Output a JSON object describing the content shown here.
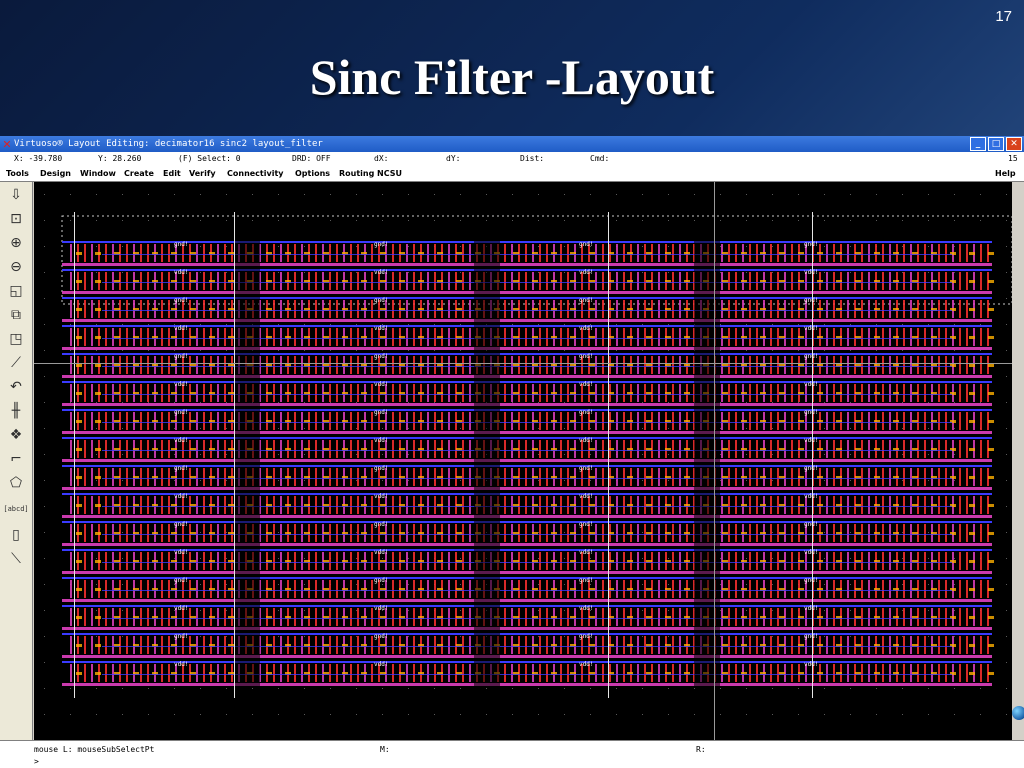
{
  "slide": {
    "number": "17",
    "title": "Sinc Filter -Layout"
  },
  "window": {
    "title": "Virtuoso® Layout Editing: decimator16 sinc2 layout_filter",
    "controls": [
      "minimize",
      "maximize",
      "close"
    ]
  },
  "status": {
    "x": "X: -39.780",
    "y": "Y: 28.260",
    "select": "(F) Select: 0",
    "drd": "DRD: OFF",
    "dx": "dX:",
    "dy": "dY:",
    "dist": "Dist:",
    "cmd": "Cmd:",
    "right_value": "15"
  },
  "menu": {
    "items": [
      "Tools",
      "Design",
      "Window",
      "Create",
      "Edit",
      "Verify",
      "Connectivity",
      "Options",
      "Routing",
      "NCSU"
    ],
    "help": "Help"
  },
  "toolbar": {
    "icons": [
      "save-icon",
      "zoom-fit-icon",
      "zoom-in-icon",
      "zoom-out-icon",
      "stretch-icon",
      "copy-icon",
      "move-icon",
      "delete-icon",
      "undo-icon",
      "property-icon",
      "instance-icon",
      "path-icon",
      "polygon-icon",
      "label-icon",
      "rectangle-icon",
      "ruler-icon"
    ],
    "label_tool": "[abcd]"
  },
  "layout": {
    "net_labels": [
      "gnd!",
      "vdd!"
    ],
    "colors": {
      "metal1": "#3a3aff",
      "metal2": "#e040c0",
      "poly": "#ff3030",
      "active": "#ffb000",
      "background": "#000000"
    }
  },
  "cmdline": {
    "mouse_l": "mouse L: mouseSubSelectPt",
    "m": "M:",
    "r": "R:",
    "prompt": ">"
  }
}
